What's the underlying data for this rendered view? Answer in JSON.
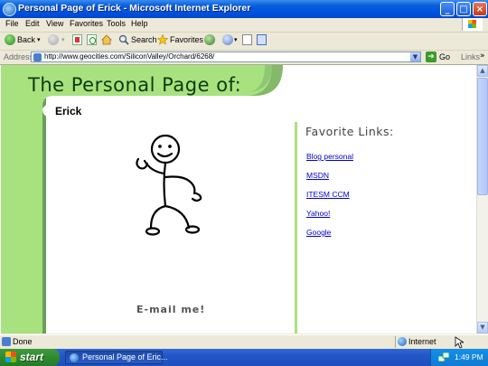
{
  "window": {
    "title": "Personal Page of Erick - Microsoft Internet Explorer"
  },
  "menu": {
    "items": [
      "File",
      "Edit",
      "View",
      "Favorites",
      "Tools",
      "Help"
    ]
  },
  "toolbar": {
    "back_label": "Back",
    "search_label": "Search",
    "favorites_label": "Favorites"
  },
  "address_bar": {
    "label": "Address",
    "url": "http://www.geocities.com/SiliconValley/Orchard/6268/",
    "go_label": "Go",
    "links_label": "Links"
  },
  "page": {
    "title": "The Personal Page of:",
    "name": "Erick",
    "favorites_heading": "Favorite Links:",
    "links": [
      "Blog personal",
      "MSDN",
      "ITESM CCM",
      "Yahoo!",
      "Google"
    ],
    "email_label": "E-mail me!",
    "colors": {
      "green_light": "#a8e27e",
      "green_mid": "#8fc874",
      "green_dark": "#6a9f5a",
      "link": "#0000cc"
    }
  },
  "status_bar": {
    "text": "Done",
    "zone": "Internet"
  },
  "taskbar": {
    "start_label": "start",
    "task_label": "Personal Page of Eric...",
    "clock": "1:49 PM"
  }
}
